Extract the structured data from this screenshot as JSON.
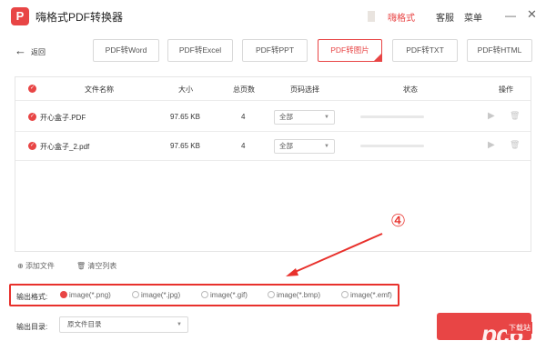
{
  "app": {
    "title": "嗨格式PDF转换器",
    "brand": "嗨格式",
    "service": "客服",
    "menu": "菜单"
  },
  "nav": {
    "back": "返回"
  },
  "tabs": [
    {
      "label": "PDF转Word"
    },
    {
      "label": "PDF转Excel"
    },
    {
      "label": "PDF转PPT"
    },
    {
      "label": "PDF转图片",
      "active": true
    },
    {
      "label": "PDF转TXT"
    },
    {
      "label": "PDF转HTML"
    }
  ],
  "table": {
    "headers": {
      "name": "文件名称",
      "size": "大小",
      "pages": "总页数",
      "page_select": "页码选择",
      "status": "状态",
      "action": "操作"
    },
    "rows": [
      {
        "name": "开心盒子.PDF",
        "size": "97.65 KB",
        "pages": "4",
        "page_select": "全部",
        "progress": 0
      },
      {
        "name": "开心盒子_2.pdf",
        "size": "97.65 KB",
        "pages": "4",
        "page_select": "全部",
        "progress": 0
      }
    ]
  },
  "actions": {
    "add_file": "添加文件",
    "clear_list": "清空列表"
  },
  "output_format": {
    "label": "输出格式:",
    "options": [
      "image(*.png)",
      "image(*.jpg)",
      "image(*.gif)",
      "image(*.bmp)",
      "image(*.emf)"
    ],
    "selected": "image(*.png)"
  },
  "output_dir": {
    "label": "输出目录:",
    "value": "原文件目录"
  },
  "annotation": {
    "step": "④"
  },
  "watermark": {
    "text": "pc6",
    "badge": "下载站",
    "url": "www.pc6.com"
  },
  "colors": {
    "accent": "#e84545",
    "annotation": "#e8312c"
  }
}
